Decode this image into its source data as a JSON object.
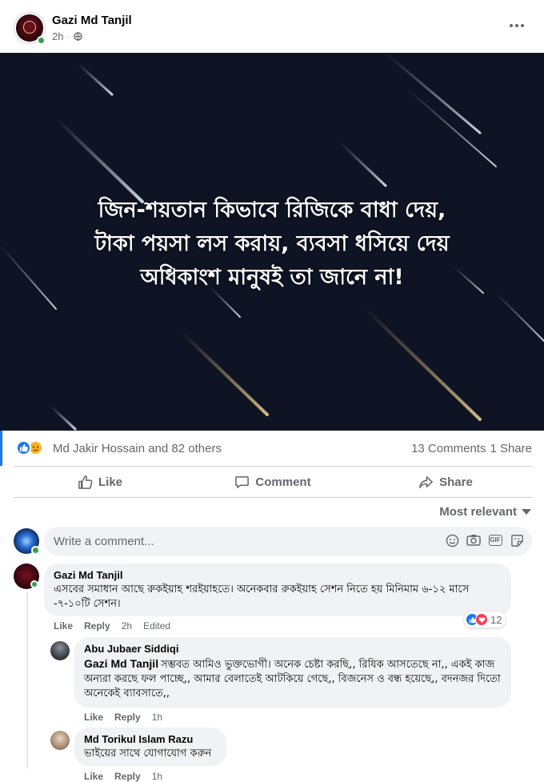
{
  "post": {
    "author": "Gazi Md Tanjil",
    "time": "2h",
    "privacy_icon": "globe-icon",
    "image_caption_lines": [
      "জিন-শয়তান কিভাবে রিজিকে বাধা দেয়,",
      "টাকা পয়সা লস করায়, ব্যবসা ধসিয়ে দেয়",
      "অধিকাংশ মানুষই তা জানে না!"
    ]
  },
  "reactions": {
    "types": [
      "like-icon",
      "sad-icon"
    ],
    "summary": "Md Jakir Hossain and 82 others",
    "comments_count": "13 Comments",
    "shares_count": "1 Share"
  },
  "actions": {
    "like": "Like",
    "comment": "Comment",
    "share": "Share"
  },
  "sort": {
    "label": "Most relevant"
  },
  "composer": {
    "placeholder": "Write a comment..."
  },
  "comments": [
    {
      "author": "Gazi Md Tanjil",
      "text": "এসবের সমাধান আছে রুকইয়াহ শরইয়াহতে। অনেকবার রুকইয়াহ সেশন নিতে হয় মিনিমাম ৬-১২ মাসে -৭-১০টি সেশন।",
      "like": "Like",
      "reply": "Reply",
      "time": "2h",
      "edited": "Edited",
      "reaction_count": "12"
    },
    {
      "author": "Abu Jubaer Siddiqi",
      "mention": "Gazi Md Tanjil",
      "text": "সম্ভবত আমিও ভুক্তভোগী। অনেক চেষ্টা করছি,, রিযিক আসতেছে না,, একই কাজ অন্যরা করছে ফল পাচ্ছে,, আমার বেলাতেই আটকিয়ে গেছে,, বিজনেস ও বন্ধ হয়েছে,, বদনজর দিতো অনেকেই ব্যাবসাতে,,",
      "like": "Like",
      "reply": "Reply",
      "time": "1h"
    },
    {
      "author": "Md Torikul Islam Razu",
      "text": "ভাইয়ের সাথে যোগাযোগ করুন",
      "like": "Like",
      "reply": "Reply",
      "time": "1h"
    }
  ]
}
